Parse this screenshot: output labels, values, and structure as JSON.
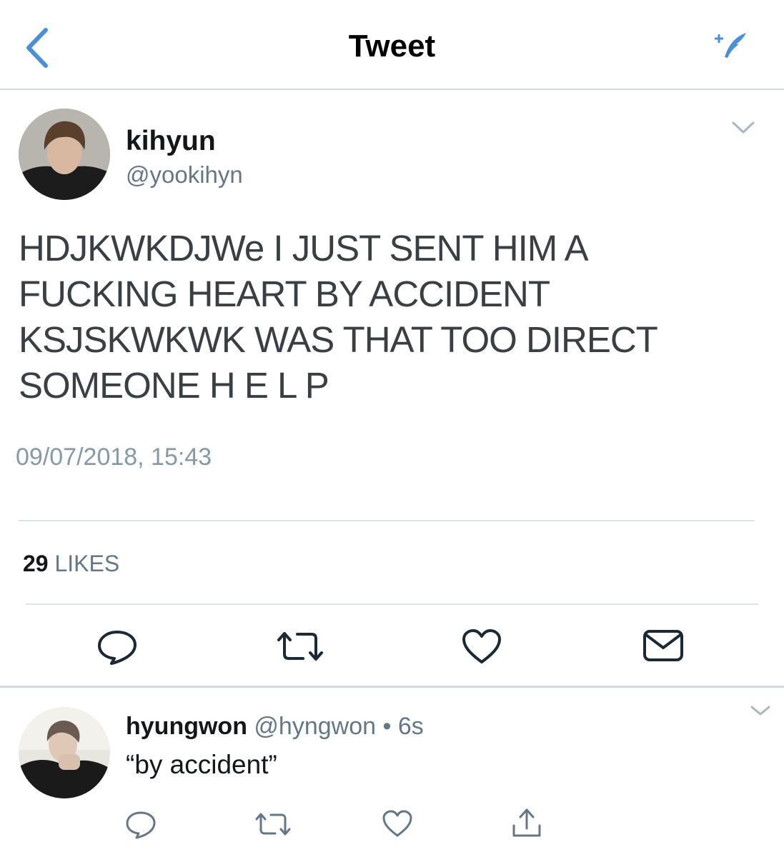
{
  "header": {
    "title": "Tweet",
    "back_icon": "chevron-left-icon",
    "compose_icon": "compose-tweet-icon",
    "accent_color": "#4a90d9"
  },
  "tweet": {
    "author_name": "kihyun",
    "author_handle": "@yookihyn",
    "text_lines": [
      "HDJKWKDJWe I JUST SENT HIM A",
      "FUCKING HEART BY ACCIDENT",
      "KSJSKWKWK WAS THAT TOO DIRECT",
      "SOMEONE H E L P"
    ],
    "timestamp": "09/07/2018, 15:43",
    "likes_count": "29",
    "likes_label": "LIKES",
    "actions": [
      "reply-icon",
      "retweet-icon",
      "like-icon",
      "direct-message-icon"
    ]
  },
  "reply": {
    "author_name": "hyungwon",
    "author_handle": "@hyngwon",
    "separator": "•",
    "time_ago": "6s",
    "text": "“by accident”",
    "actions": [
      "reply-icon",
      "retweet-icon",
      "like-icon",
      "share-icon"
    ]
  }
}
